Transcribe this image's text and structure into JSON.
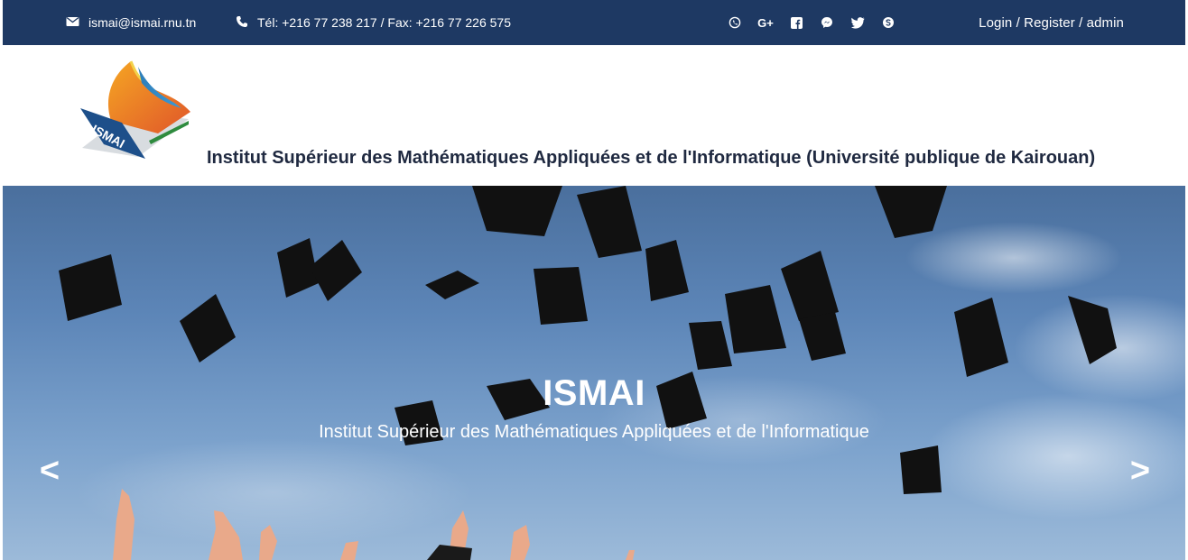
{
  "topbar": {
    "email": "ismai@ismai.rnu.tn",
    "phone": "Tél: +216 77 238 217 / Fax: +216 77 226 575",
    "social": [
      "viber-icon",
      "google-plus-icon",
      "facebook-icon",
      "messenger-icon",
      "twitter-icon",
      "skype-icon"
    ],
    "auth": "Login / Register / admin"
  },
  "header": {
    "logo_text": "ISMAI",
    "title": "Institut Supérieur des Mathématiques Appliquées et de l'Informatique (Université publique de Kairouan)"
  },
  "hero": {
    "title": "ISMAI",
    "subtitle": "Institut Supérieur des Mathématiques Appliquées et de l'Informatique",
    "prev": "<",
    "next": ">"
  },
  "colors": {
    "topbar": "#1e3963",
    "sky": "#5d86b8",
    "title_text": "#1f2940"
  }
}
